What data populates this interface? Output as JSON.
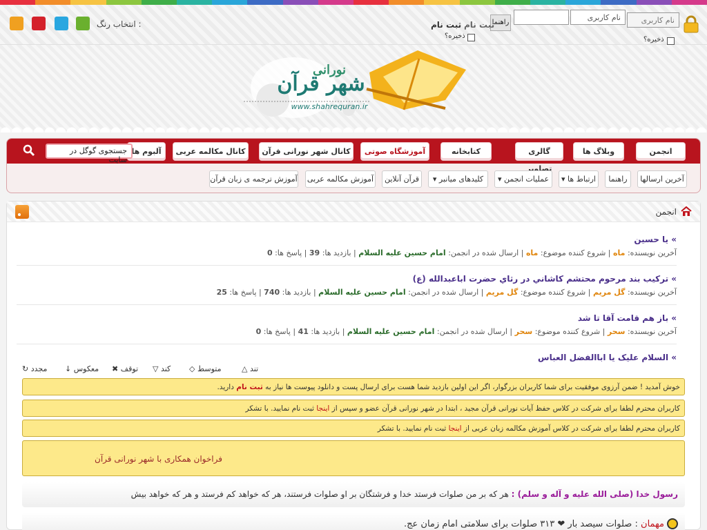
{
  "colors": {
    "stripe": [
      "#e7303f",
      "#f28d2a",
      "#f6c343",
      "#8cc63f",
      "#3fae49",
      "#2ab3a1",
      "#2aa6d9",
      "#3d6bc4",
      "#8a4fb8",
      "#d53a8b",
      "#e7303f",
      "#f28d2a",
      "#f6c343",
      "#8cc63f",
      "#3fae49",
      "#2ab3a1",
      "#2aa6d9",
      "#3d6bc4",
      "#8a4fb8",
      "#d53a8b"
    ],
    "picker": [
      "#f0a020",
      "#d4212b",
      "#2aa7e0",
      "#6ab02e"
    ],
    "accent": "#b8141e"
  },
  "login": {
    "username_placeholder": "نام کاربری",
    "username_value": "نام کاربری",
    "help_label": "راهنما",
    "register_label": "ثبت نام",
    "remember_label": "ذخیره؟",
    "remember_label_2": "ذخیره؟"
  },
  "color_picker": {
    "label": "انتخاب رنگ :"
  },
  "site": {
    "logo_text": "شهر قرآن",
    "logo_subtext": "نورانی",
    "logo_url": "www.shahrequran.ir"
  },
  "nav": {
    "items": [
      "انجمن",
      "وبلاگ ها",
      "گالری تصاویر",
      "کتابخانه",
      "آموزشگاه صوتی",
      "کانال شهر نورانی قرآن",
      "کانال مکالمه عربی",
      "آلبوم ها"
    ],
    "search_text": "جستجوی گوگل در سایت"
  },
  "subnav": {
    "items": [
      "آخرین ارسالها",
      "راهنما",
      "ارتباط ها",
      "عملیات انجمن",
      "کلیدهای میانبر",
      "قرآن آنلاین",
      "آموزش مکالمه عربی",
      "آموزش ترجمه ی زبان قرآن"
    ]
  },
  "breadcrumb": {
    "label": "انجمن"
  },
  "topics": [
    {
      "title": "» یا حسین",
      "author": "ماه",
      "starter": "ماه",
      "forum": "امام حسین علیه السلام",
      "views": "39",
      "replies": "0"
    },
    {
      "title": "» ترکيب بند مرحوم محتشم کاشاني در رثاي حضرت اباعبدالله (ع)",
      "author": "گل مریم",
      "starter": "گل مریم",
      "forum": "امام حسین علیه السلام",
      "views": "740",
      "replies": "25"
    },
    {
      "title": "» باز هم قامت آقا تا شد",
      "author": "سحر",
      "starter": "سحر",
      "forum": "امام حسین علیه السلام",
      "views": "41",
      "replies": "0"
    }
  ],
  "topic_labels": {
    "last": "آخرین نویسنده:",
    "starter": "شروع کننده موضوع:",
    "forum": "ارسال شده در انجمن:",
    "views": "بازدید ها:",
    "replies": "پاسخ ها:"
  },
  "topic4": {
    "title": "» السلام علیک یا اباالفضل العباس"
  },
  "controls": {
    "fast": "تند",
    "medium": "متوسط",
    "slow": "کند",
    "stop": "توقف",
    "reverse": "معکوس",
    "restart": "مجدد"
  },
  "notices": [
    {
      "pre": "خوش آمدید ! ضمن آرزوی موفقیت برای شما کاربران بزرگوار، اگر این اولین بازدید شما هست برای ارسال پست و دانلود پیوست ها نیاز به ",
      "link": "ثبت نام",
      "post": " دارید."
    },
    {
      "pre": "کاربران محترم لطفا برای شرکت در کلاس حفظ آیات نورانی قرآن مجید ، ابتدا در شهر نورانی قرآن عضو و سپس از ",
      "link": "اینجا",
      "post": " ثبت نام نمایید. با تشکر"
    },
    {
      "pre": "کاربران محترم لطفا برای شرکت در کلاس آموزش مکالمه زبان عربی از ",
      "link": "اینجا",
      "post": " ثبت نام نمایید. با تشکر"
    }
  ],
  "callout": {
    "text": "فراخوان همکاری با شهر نورانی قرآن"
  },
  "quote": {
    "who": "رسول خدا (صلی الله علیه و آله و سلم) :",
    "text": " هر که بر من صلوات فرستد خدا و فرشتگان بر او صلوات فرستند، هر که خواهد کم فرستد و هر که خواهد بیش"
  },
  "shout": {
    "name": "مهمان",
    "text": "صلوات سیصد بار ❤ ۳۱۳ صلوات برای سلامتی امام زمان عج."
  }
}
